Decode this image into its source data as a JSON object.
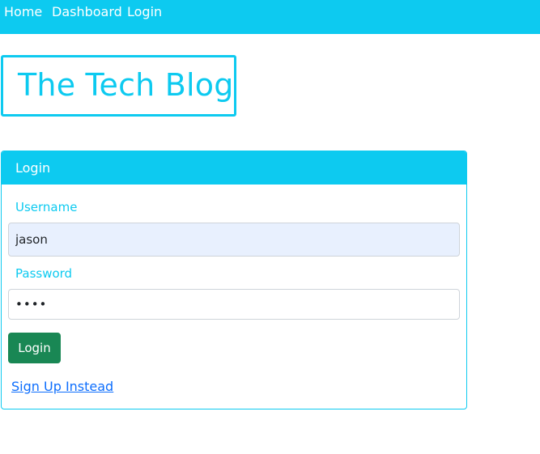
{
  "nav": {
    "items": [
      "Home",
      "Dashboard",
      "Login"
    ]
  },
  "site": {
    "title": "The Tech Blog"
  },
  "login_form": {
    "header": "Login",
    "username_label": "Username",
    "username_value": "jason",
    "password_label": "Password",
    "password_value": "pass",
    "submit_label": "Login",
    "signup_link": "Sign Up Instead"
  },
  "colors": {
    "accent": "#0dcaf0",
    "success": "#198754",
    "link": "#0d6efd",
    "autofill_bg": "#e8f0fe"
  }
}
